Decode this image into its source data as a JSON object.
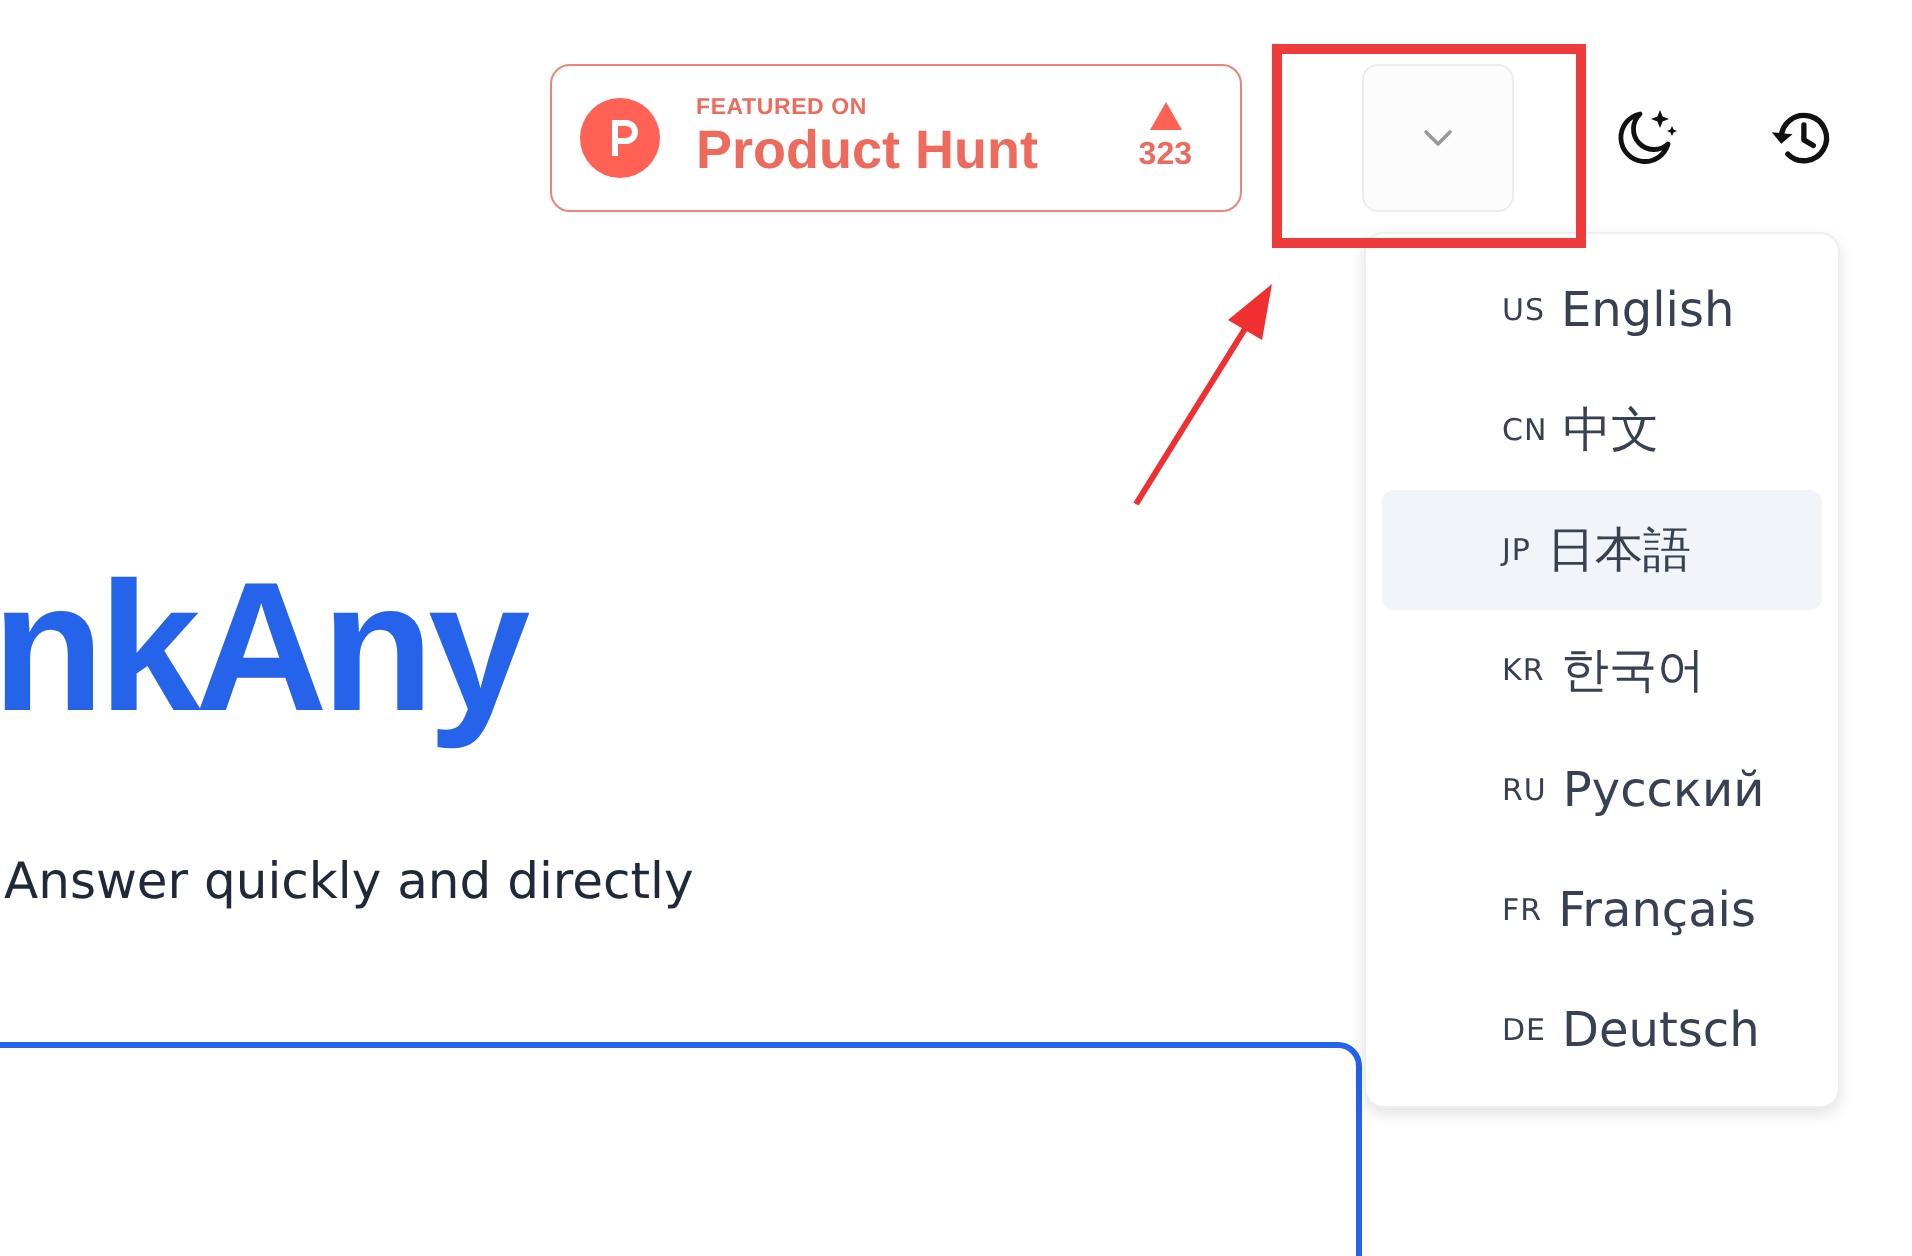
{
  "header": {
    "product_hunt_badge": {
      "kicker": "FEATURED ON",
      "name": "Product Hunt",
      "upvotes": "323"
    }
  },
  "language_menu": {
    "expanded": true,
    "items": [
      {
        "code": "US",
        "label": "English",
        "selected": false
      },
      {
        "code": "CN",
        "label": "中文",
        "selected": false
      },
      {
        "code": "JP",
        "label": "日本語",
        "selected": true
      },
      {
        "code": "KR",
        "label": "한국어",
        "selected": false
      },
      {
        "code": "RU",
        "label": "Русский",
        "selected": false
      },
      {
        "code": "FR",
        "label": "Français",
        "selected": false
      },
      {
        "code": "DE",
        "label": "Deutsch",
        "selected": false
      }
    ]
  },
  "hero": {
    "title": "nkAny",
    "subtitle": "Answer quickly and directly"
  }
}
